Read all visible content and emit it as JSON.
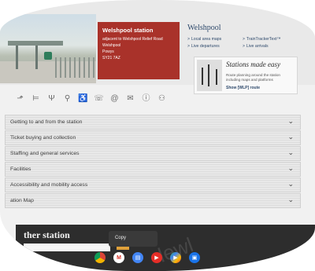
{
  "station": {
    "name": "Welshpool station",
    "address_lines": [
      "adjacent to Welshpool Relief Road",
      "Welshpool",
      "Powys",
      "SY21 7AZ"
    ]
  },
  "panel": {
    "title": "Welshpool",
    "links": [
      {
        "label": "Local area maps"
      },
      {
        "label": "TrainTrackerText™"
      },
      {
        "label": "Live departures"
      },
      {
        "label": "Live arrivals"
      }
    ]
  },
  "stations_made_easy": {
    "title": "Stations made easy",
    "description": "Route planning around the station including maps and platforms",
    "link": "Show [WLP] route"
  },
  "facility_icons": [
    "step-free-icon",
    "bed-icon",
    "food-icon",
    "toilets-icon",
    "accessible-toilets-icon",
    "phone-icon",
    "at-icon",
    "mail-icon",
    "info-icon",
    "family-icon"
  ],
  "accordion": [
    {
      "label": "Getting to and from the station"
    },
    {
      "label": "Ticket buying and collection"
    },
    {
      "label": "Staffing and general services"
    },
    {
      "label": "Facilities"
    },
    {
      "label": "Accessibility and mobility access"
    },
    {
      "label": "ation Map"
    }
  ],
  "bottom": {
    "partial_title": "ther station",
    "copy_label": "Copy"
  },
  "taskbar": [
    {
      "name": "chrome-icon",
      "color": "#e0483e"
    },
    {
      "name": "gmail-icon",
      "color": "#d93025"
    },
    {
      "name": "docs-icon",
      "color": "#4285f4"
    },
    {
      "name": "youtube-icon",
      "color": "#e52d27"
    },
    {
      "name": "play-store-icon",
      "color": "#34a853"
    },
    {
      "name": "files-icon",
      "color": "#1a73e8"
    }
  ],
  "colors": {
    "station_red": "#a9322a",
    "link_blue": "#2f4a6c"
  }
}
